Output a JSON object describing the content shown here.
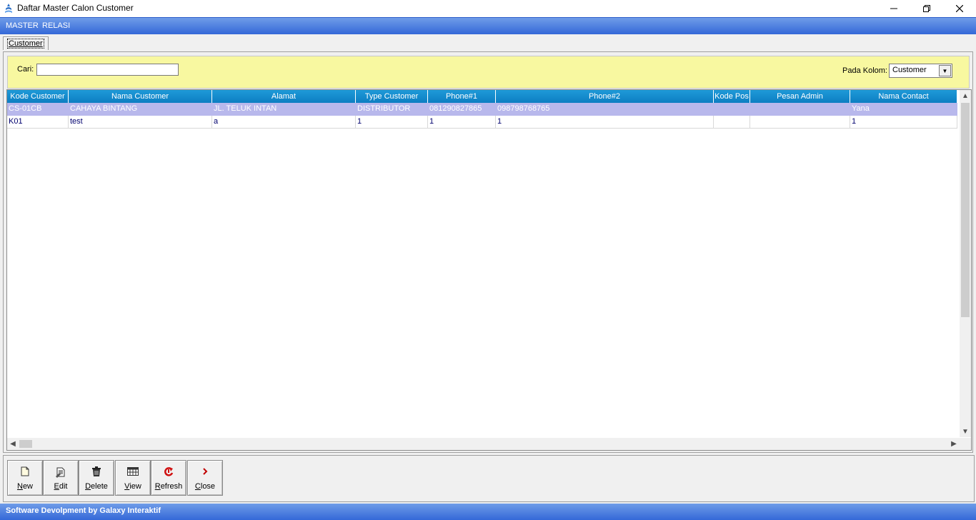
{
  "window": {
    "title": "Daftar Master Calon Customer",
    "minimize_icon": "minimize-icon",
    "maximize_icon": "restore-icon",
    "close_icon": "close-icon"
  },
  "menu": {
    "items": [
      {
        "label": "MASTER"
      },
      {
        "label": "RELASI"
      }
    ]
  },
  "tabs": [
    {
      "label": "Customer",
      "active": true
    }
  ],
  "search": {
    "label": "Cari:",
    "value": "",
    "column_label": "Pada Kolom:",
    "column_value": "Customer"
  },
  "grid": {
    "columns": [
      "Kode Customer",
      "Nama Customer",
      "Alamat",
      "Type Customer",
      "Phone#1",
      "Phone#2",
      "Kode Pos",
      "Pesan Admin",
      "Nama Contact"
    ],
    "rows": [
      [
        "CS-01CB",
        "CAHAYA BINTANG",
        "JL. TELUK INTAN",
        "DISTRIBUTOR",
        "081290827865",
        "098798768765",
        "",
        "",
        "Yana"
      ],
      [
        "K01",
        "test",
        "a",
        "1",
        "1",
        "1",
        "",
        "",
        "1"
      ]
    ],
    "selected_row": 0
  },
  "toolbar": {
    "buttons": [
      {
        "label": "New",
        "icon": "new-document-icon"
      },
      {
        "label": "Edit",
        "icon": "edit-document-icon"
      },
      {
        "label": "Delete",
        "icon": "trash-icon"
      },
      {
        "label": "View",
        "icon": "table-view-icon"
      },
      {
        "label": "Refresh",
        "icon": "refresh-icon"
      },
      {
        "label": "Close",
        "icon": "chevron-right-icon"
      }
    ]
  },
  "status": {
    "text": "Software Devolpment by Galaxy Interaktif"
  },
  "colors": {
    "header_blue": "#1a94d4",
    "menubar_blue": "#3468d8",
    "search_yellow": "#f8f8a0",
    "selected_row": "#b8b8ec"
  }
}
